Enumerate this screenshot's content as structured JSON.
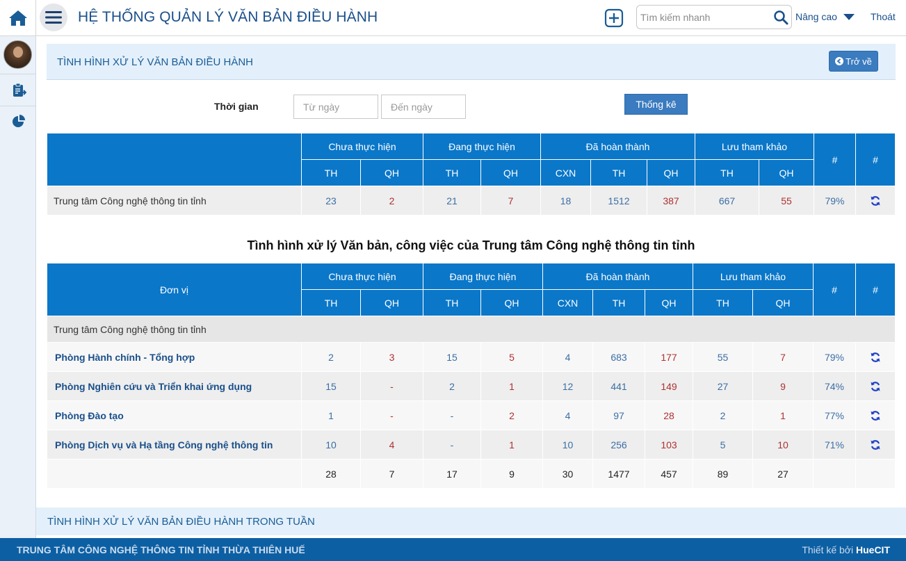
{
  "header": {
    "title": "HỆ THỐNG QUẢN LÝ VĂN BẢN ĐIỀU HÀNH",
    "search_placeholder": "Tìm kiếm nhanh",
    "advanced_label": "Nâng cao",
    "logout_label": "Thoát"
  },
  "panel": {
    "title": "TÌNH HÌNH XỬ LÝ VĂN BẢN ĐIỀU HÀNH",
    "back_label": "Trở về"
  },
  "filter": {
    "label": "Thời gian",
    "from_placeholder": "Từ ngày",
    "to_placeholder": "Đến ngày",
    "submit_label": "Thống kê"
  },
  "columns": {
    "groups": [
      "Chưa thực hiện",
      "Đang thực hiện",
      "Đã hoàn thành",
      "Lưu tham khảo"
    ],
    "sub": [
      "TH",
      "QH",
      "TH",
      "QH",
      "CXN",
      "TH",
      "QH",
      "TH",
      "QH"
    ],
    "hash": "#",
    "unit": "Đơn vị"
  },
  "summary": {
    "name": "Trung tâm Công nghệ thông tin tỉnh",
    "values": [
      "23",
      "2",
      "21",
      "7",
      "18",
      "1512",
      "387",
      "667",
      "55"
    ],
    "percent": "79%"
  },
  "detail": {
    "title": "Tình hình xử lý Văn bản, công việc của Trung tâm Công nghệ thông tin tỉnh",
    "group_row": "Trung tâm Công nghệ thông tin tỉnh",
    "rows": [
      {
        "name": "Phòng Hành chính - Tổng hợp",
        "values": [
          "2",
          "3",
          "15",
          "5",
          "4",
          "683",
          "177",
          "55",
          "7"
        ],
        "percent": "79%"
      },
      {
        "name": "Phòng Nghiên cứu và Triển khai ứng dụng",
        "values": [
          "15",
          "-",
          "2",
          "1",
          "12",
          "441",
          "149",
          "27",
          "9"
        ],
        "percent": "74%"
      },
      {
        "name": "Phòng Đào tạo",
        "values": [
          "1",
          "-",
          "-",
          "2",
          "4",
          "97",
          "28",
          "2",
          "1"
        ],
        "percent": "77%"
      },
      {
        "name": "Phòng Dịch vụ và Hạ tầng Công nghệ thông tin",
        "values": [
          "10",
          "4",
          "-",
          "1",
          "10",
          "256",
          "103",
          "5",
          "10"
        ],
        "percent": "71%"
      }
    ],
    "totals": [
      "28",
      "7",
      "17",
      "9",
      "30",
      "1477",
      "457",
      "89",
      "27"
    ]
  },
  "week_panel": {
    "title": "TÌNH HÌNH XỬ LÝ VĂN BẢN ĐIỀU HÀNH TRONG TUẦN"
  },
  "footer": {
    "left": "TRUNG TÂM CÔNG NGHỆ THÔNG TIN TỈNH THỪA THIÊN HUẾ",
    "designed_by": "Thiết kế bởi",
    "brand": "HueCIT"
  },
  "colors": {
    "table_header": "#0a77c9",
    "button": "#3b7bbf",
    "footer": "#0d5fa3",
    "value_blue": "#3a6ea5",
    "value_red": "#b03030"
  },
  "icons": {
    "home": "home-icon",
    "menu": "hamburger-icon",
    "add": "plus-square-icon",
    "search": "search-icon",
    "advanced": "caret-down-icon",
    "documents": "clipboard-icon",
    "report": "pie-chart-icon",
    "refresh": "refresh-icon"
  }
}
